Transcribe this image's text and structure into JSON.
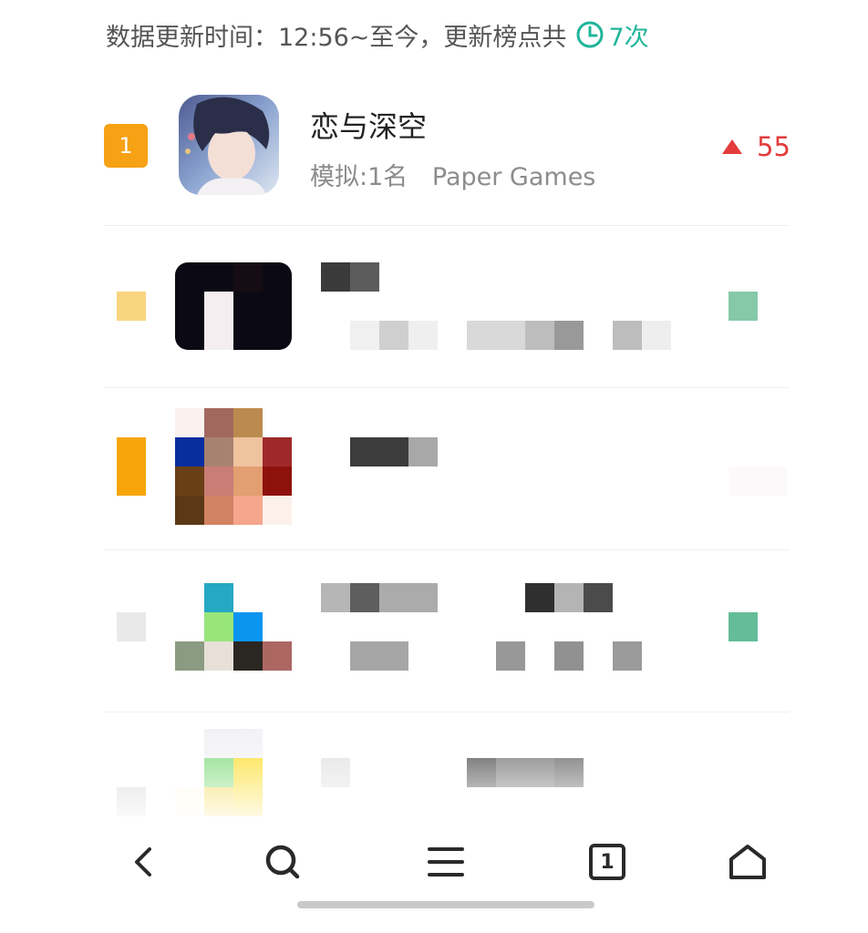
{
  "header": {
    "update_text": "数据更新时间：12:56~至今，更新榜点共",
    "update_count": "7次",
    "accent_color": "#1fb59a",
    "clock_icon": "clock-icon"
  },
  "list": {
    "items": [
      {
        "rank": "1",
        "name": "恋与深空",
        "category": "模拟:1名",
        "developer": "Paper Games",
        "trend_direction": "up",
        "trend_value": "55",
        "trend_color": "#e33b3b"
      }
    ]
  },
  "nav": {
    "back_icon": "chevron-left-icon",
    "search_icon": "search-icon",
    "menu_icon": "menu-icon",
    "tabs_icon": "tabs-icon",
    "tabs_count": "1",
    "home_icon": "home-icon"
  }
}
